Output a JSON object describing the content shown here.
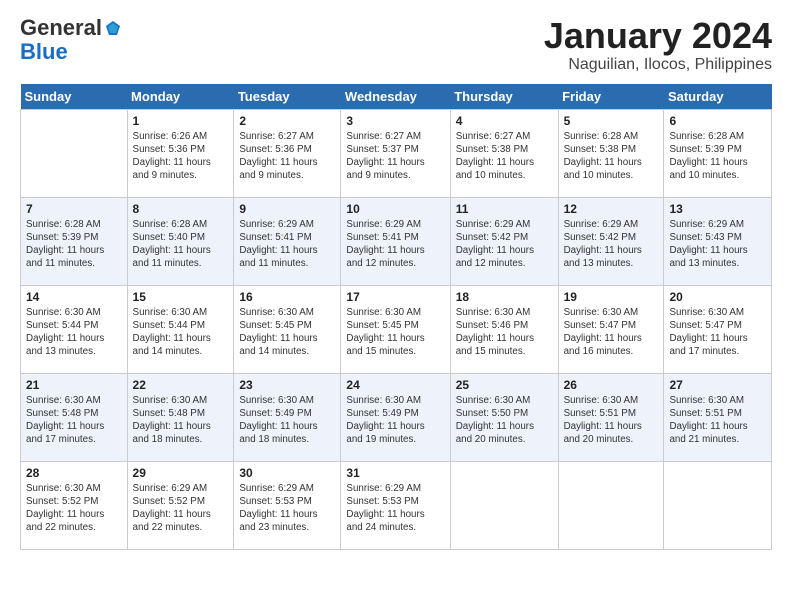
{
  "header": {
    "logo_line1": "General",
    "logo_line2": "Blue",
    "month": "January 2024",
    "location": "Naguilian, Ilocos, Philippines"
  },
  "weekdays": [
    "Sunday",
    "Monday",
    "Tuesday",
    "Wednesday",
    "Thursday",
    "Friday",
    "Saturday"
  ],
  "weeks": [
    [
      {
        "day": "",
        "info": ""
      },
      {
        "day": "1",
        "info": "Sunrise: 6:26 AM\nSunset: 5:36 PM\nDaylight: 11 hours\nand 9 minutes."
      },
      {
        "day": "2",
        "info": "Sunrise: 6:27 AM\nSunset: 5:36 PM\nDaylight: 11 hours\nand 9 minutes."
      },
      {
        "day": "3",
        "info": "Sunrise: 6:27 AM\nSunset: 5:37 PM\nDaylight: 11 hours\nand 9 minutes."
      },
      {
        "day": "4",
        "info": "Sunrise: 6:27 AM\nSunset: 5:38 PM\nDaylight: 11 hours\nand 10 minutes."
      },
      {
        "day": "5",
        "info": "Sunrise: 6:28 AM\nSunset: 5:38 PM\nDaylight: 11 hours\nand 10 minutes."
      },
      {
        "day": "6",
        "info": "Sunrise: 6:28 AM\nSunset: 5:39 PM\nDaylight: 11 hours\nand 10 minutes."
      }
    ],
    [
      {
        "day": "7",
        "info": "Sunrise: 6:28 AM\nSunset: 5:39 PM\nDaylight: 11 hours\nand 11 minutes."
      },
      {
        "day": "8",
        "info": "Sunrise: 6:28 AM\nSunset: 5:40 PM\nDaylight: 11 hours\nand 11 minutes."
      },
      {
        "day": "9",
        "info": "Sunrise: 6:29 AM\nSunset: 5:41 PM\nDaylight: 11 hours\nand 11 minutes."
      },
      {
        "day": "10",
        "info": "Sunrise: 6:29 AM\nSunset: 5:41 PM\nDaylight: 11 hours\nand 12 minutes."
      },
      {
        "day": "11",
        "info": "Sunrise: 6:29 AM\nSunset: 5:42 PM\nDaylight: 11 hours\nand 12 minutes."
      },
      {
        "day": "12",
        "info": "Sunrise: 6:29 AM\nSunset: 5:42 PM\nDaylight: 11 hours\nand 13 minutes."
      },
      {
        "day": "13",
        "info": "Sunrise: 6:29 AM\nSunset: 5:43 PM\nDaylight: 11 hours\nand 13 minutes."
      }
    ],
    [
      {
        "day": "14",
        "info": "Sunrise: 6:30 AM\nSunset: 5:44 PM\nDaylight: 11 hours\nand 13 minutes."
      },
      {
        "day": "15",
        "info": "Sunrise: 6:30 AM\nSunset: 5:44 PM\nDaylight: 11 hours\nand 14 minutes."
      },
      {
        "day": "16",
        "info": "Sunrise: 6:30 AM\nSunset: 5:45 PM\nDaylight: 11 hours\nand 14 minutes."
      },
      {
        "day": "17",
        "info": "Sunrise: 6:30 AM\nSunset: 5:45 PM\nDaylight: 11 hours\nand 15 minutes."
      },
      {
        "day": "18",
        "info": "Sunrise: 6:30 AM\nSunset: 5:46 PM\nDaylight: 11 hours\nand 15 minutes."
      },
      {
        "day": "19",
        "info": "Sunrise: 6:30 AM\nSunset: 5:47 PM\nDaylight: 11 hours\nand 16 minutes."
      },
      {
        "day": "20",
        "info": "Sunrise: 6:30 AM\nSunset: 5:47 PM\nDaylight: 11 hours\nand 17 minutes."
      }
    ],
    [
      {
        "day": "21",
        "info": "Sunrise: 6:30 AM\nSunset: 5:48 PM\nDaylight: 11 hours\nand 17 minutes."
      },
      {
        "day": "22",
        "info": "Sunrise: 6:30 AM\nSunset: 5:48 PM\nDaylight: 11 hours\nand 18 minutes."
      },
      {
        "day": "23",
        "info": "Sunrise: 6:30 AM\nSunset: 5:49 PM\nDaylight: 11 hours\nand 18 minutes."
      },
      {
        "day": "24",
        "info": "Sunrise: 6:30 AM\nSunset: 5:49 PM\nDaylight: 11 hours\nand 19 minutes."
      },
      {
        "day": "25",
        "info": "Sunrise: 6:30 AM\nSunset: 5:50 PM\nDaylight: 11 hours\nand 20 minutes."
      },
      {
        "day": "26",
        "info": "Sunrise: 6:30 AM\nSunset: 5:51 PM\nDaylight: 11 hours\nand 20 minutes."
      },
      {
        "day": "27",
        "info": "Sunrise: 6:30 AM\nSunset: 5:51 PM\nDaylight: 11 hours\nand 21 minutes."
      }
    ],
    [
      {
        "day": "28",
        "info": "Sunrise: 6:30 AM\nSunset: 5:52 PM\nDaylight: 11 hours\nand 22 minutes."
      },
      {
        "day": "29",
        "info": "Sunrise: 6:29 AM\nSunset: 5:52 PM\nDaylight: 11 hours\nand 22 minutes."
      },
      {
        "day": "30",
        "info": "Sunrise: 6:29 AM\nSunset: 5:53 PM\nDaylight: 11 hours\nand 23 minutes."
      },
      {
        "day": "31",
        "info": "Sunrise: 6:29 AM\nSunset: 5:53 PM\nDaylight: 11 hours\nand 24 minutes."
      },
      {
        "day": "",
        "info": ""
      },
      {
        "day": "",
        "info": ""
      },
      {
        "day": "",
        "info": ""
      }
    ]
  ]
}
